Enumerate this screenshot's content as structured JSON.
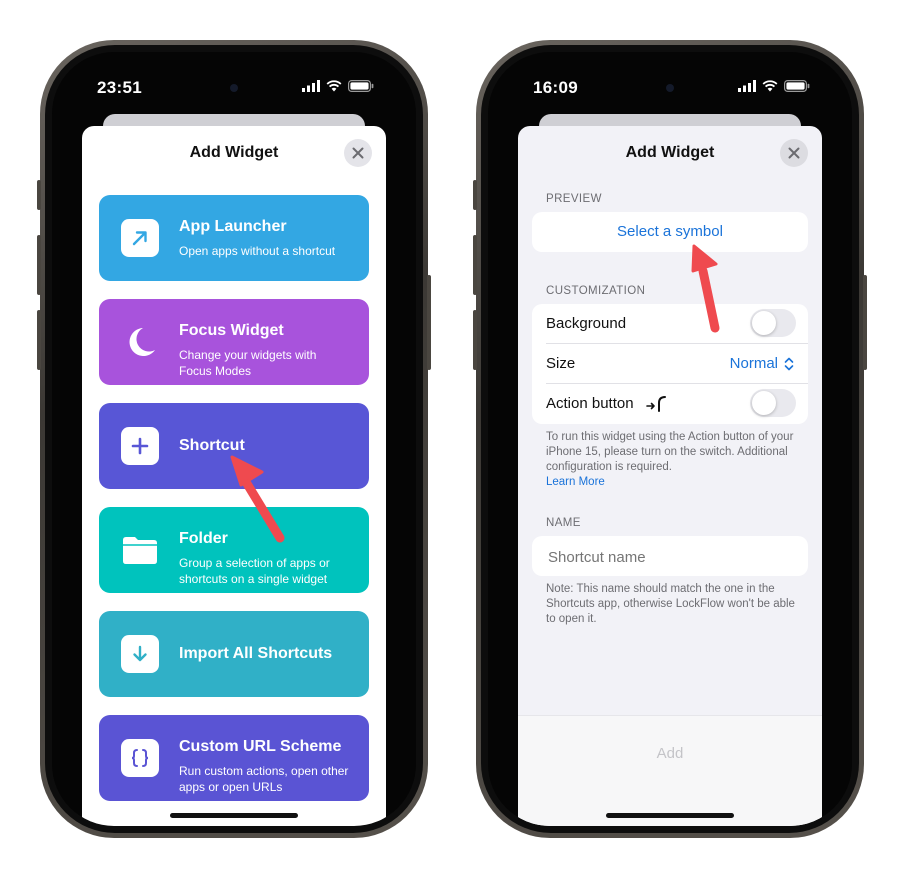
{
  "left_phone": {
    "status_time": "23:51",
    "sheet_title": "Add Widget",
    "cards": [
      {
        "title": "App Launcher",
        "desc": "Open apps without a shortcut",
        "color": "#33a7e3",
        "icon": "arrow-up-right-icon"
      },
      {
        "title": "Focus Widget",
        "desc": "Change your widgets with Focus Modes",
        "color": "#a853dc",
        "icon": "moon-icon"
      },
      {
        "title": "Shortcut",
        "desc": "",
        "color": "#5856d6",
        "icon": "plus-icon"
      },
      {
        "title": "Folder",
        "desc": "Group a selection of apps or shortcuts on a single widget",
        "color": "#00c3bd",
        "icon": "folder-icon"
      },
      {
        "title": "Import All Shortcuts",
        "desc": "",
        "color": "#30b0c7",
        "icon": "arrow-down-icon"
      },
      {
        "title": "Custom URL Scheme",
        "desc": "Run custom actions, open other apps or open URLs",
        "color": "#5a54d4",
        "icon": "braces-icon"
      }
    ]
  },
  "right_phone": {
    "status_time": "16:09",
    "sheet_title": "Add Widget",
    "preview_label": "PREVIEW",
    "select_symbol": "Select a symbol",
    "customization_label": "CUSTOMIZATION",
    "background_label": "Background",
    "background_on": false,
    "size_label": "Size",
    "size_value": "Normal",
    "action_label": "Action button",
    "action_on": false,
    "action_note": "To run this widget using the Action button of your iPhone 15, please turn on the switch. Additional configuration is required.",
    "learn_more": "Learn More",
    "name_label": "NAME",
    "name_placeholder": "Shortcut name",
    "name_note": "Note: This name should match the one in the Shortcuts app, otherwise LockFlow won't be able to open it.",
    "add_button": "Add"
  },
  "colors": {
    "accent": "#1a73d9",
    "annotation_arrow": "#ef4a4f"
  }
}
